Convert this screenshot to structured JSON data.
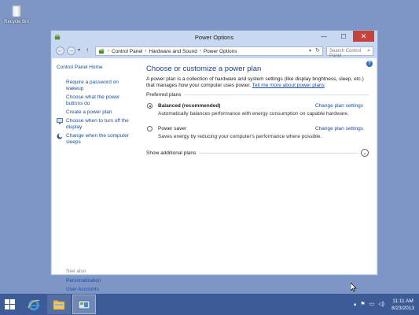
{
  "desktop": {
    "recycle_bin_label": "Recycle Bin"
  },
  "window": {
    "title": "Power Options",
    "controls": {
      "minimize": "—",
      "maximize": "☐",
      "close": "✕"
    }
  },
  "address_bar": {
    "breadcrumbs": [
      "Control Panel",
      "Hardware and Sound",
      "Power Options"
    ],
    "search_placeholder": "Search Control Panel"
  },
  "left_nav": {
    "home": "Control Panel Home",
    "items": [
      {
        "label": "Require a password on wakeup",
        "icon": "none"
      },
      {
        "label": "Choose what the power buttons do",
        "icon": "none"
      },
      {
        "label": "Create a power plan",
        "icon": "none"
      },
      {
        "label": "Choose when to turn off the display",
        "icon": "monitor-icon"
      },
      {
        "label": "Change when the computer sleeps",
        "icon": "moon-icon"
      }
    ],
    "see_also_heading": "See also",
    "see_also": [
      "Personalization",
      "User Accounts"
    ]
  },
  "main": {
    "heading": "Choose or customize a power plan",
    "description": "A power plan is a collection of hardware and system settings (like display brightness, sleep, etc.) that manages how your computer uses power.",
    "learn_more": "Tell me more about power plans",
    "preferred_plans_label": "Preferred plans",
    "plans": [
      {
        "name": "Balanced (recommended)",
        "selected": true,
        "description": "Automatically balances performance with energy consumption on capable hardware.",
        "change_link": "Change plan settings"
      },
      {
        "name": "Power saver",
        "selected": false,
        "description": "Saves energy by reducing your computer's performance where possible.",
        "change_link": "Change plan settings"
      }
    ],
    "show_additional": "Show additional plans"
  },
  "taskbar": {
    "clock_time": "11:11 AM",
    "clock_date": "8/23/2013",
    "pinned": [
      "internet-explorer-icon",
      "file-explorer-icon",
      "control-panel-icon"
    ]
  },
  "colors": {
    "desktop": "#7e96c6",
    "window_frame": "#c8d8f0",
    "link": "#1a4fa0",
    "heading": "#1c3f94",
    "close": "#c7423a",
    "taskbar": "#3c5b97"
  }
}
